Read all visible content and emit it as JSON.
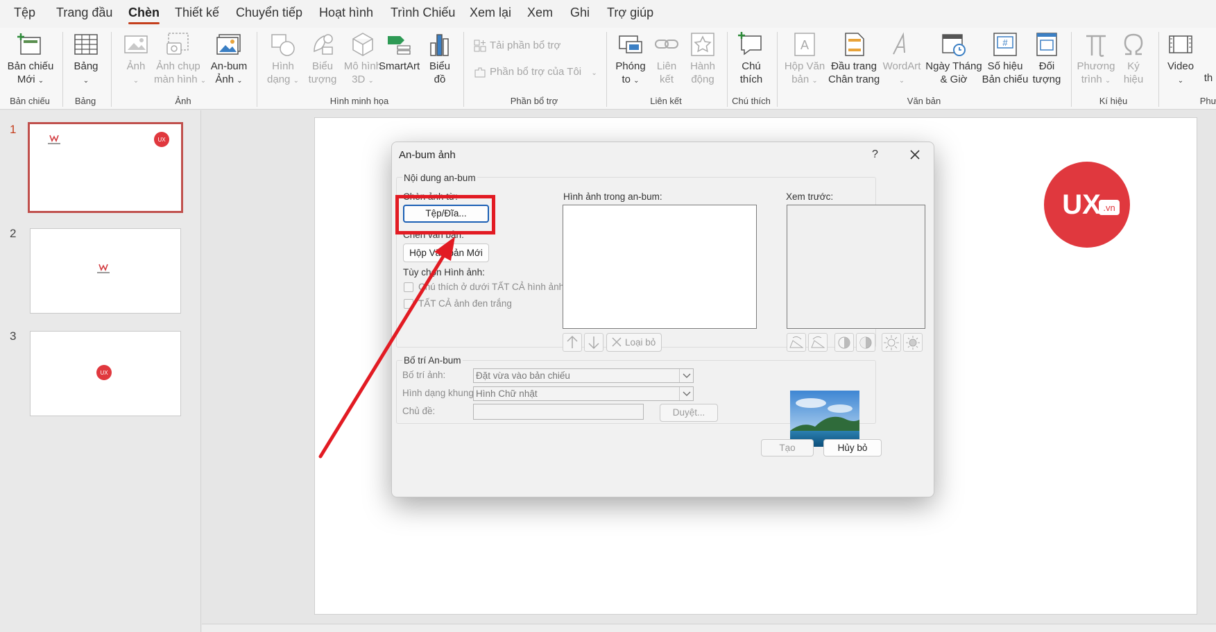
{
  "menu": {
    "items": [
      "Tệp",
      "Trang đầu",
      "Chèn",
      "Thiết kế",
      "Chuyển tiếp",
      "Hoạt hình",
      "Trình Chiếu",
      "Xem lại",
      "Xem",
      "Ghi",
      "Trợ giúp"
    ],
    "active": "Chèn"
  },
  "ribbon": {
    "new_slide": {
      "line1": "Bản chiếu",
      "line2": "Mới"
    },
    "table": {
      "line1": "Bảng"
    },
    "picture": {
      "line1": "Ảnh"
    },
    "screenshot": {
      "line1": "Ảnh chụp",
      "line2": "màn hình"
    },
    "album": {
      "line1": "An-bum",
      "line2": "Ảnh"
    },
    "shapes": {
      "line1": "Hình",
      "line2": "dạng"
    },
    "icons": {
      "line1": "Biểu",
      "line2": "tượng"
    },
    "models3d": {
      "line1": "Mô hình",
      "line2": "3D"
    },
    "smartart": {
      "line1": "SmartArt"
    },
    "chart": {
      "line1": "Biểu",
      "line2": "đồ"
    },
    "get_addins": "Tải phần bổ trợ",
    "my_addins": "Phần bổ trợ của Tôi",
    "zoom": {
      "line1": "Phóng",
      "line2": "to"
    },
    "link": {
      "line1": "Liên",
      "line2": "kết"
    },
    "action": {
      "line1": "Hành",
      "line2": "động"
    },
    "comment": {
      "line1": "Chú",
      "line2": "thích"
    },
    "textbox": {
      "line1": "Hộp Văn",
      "line2": "bản"
    },
    "header_footer": {
      "line1": "Đầu trang",
      "line2": "Chân trang"
    },
    "wordart": {
      "line1": "WordArt"
    },
    "datetime": {
      "line1": "Ngày Tháng",
      "line2": "& Giờ"
    },
    "slide_number": {
      "line1": "Số hiệu",
      "line2": "Bản chiếu"
    },
    "object": {
      "line1": "Đối",
      "line2": "tượng"
    },
    "equation": {
      "line1": "Phương",
      "line2": "trình"
    },
    "symbol": {
      "line1": "Ký",
      "line2": "hiệu"
    },
    "video": {
      "line1": "Video"
    },
    "cut1": "th",
    "groups": {
      "slides": "Bản chiếu",
      "tables": "Bảng",
      "images": "Ảnh",
      "illustrations": "Hình minh họa",
      "addins": "Phần bổ trợ",
      "links": "Liên kết",
      "comments": "Chú thích",
      "text": "Văn bản",
      "symbols": "Kí hiệu",
      "media_cut": "Phư"
    }
  },
  "thumbnails": [
    "1",
    "2",
    "3"
  ],
  "slide": {
    "logo_text": "UX",
    "logo_suffix": ".vn",
    "brand_color": "#e0383e"
  },
  "dialog": {
    "title": "An-bum ảnh",
    "help": "?",
    "album_content": "Nội dung an-bum",
    "insert_picture_from": "Chèn ảnh từ:",
    "file_disk_button": "Tệp/Đĩa...",
    "insert_text": "Chèn văn bản:",
    "new_textbox_button": "Hộp Văn bản Mới",
    "picture_options": "Tùy chọn Hình ảnh:",
    "caption_below": "Chú thích ở dưới TẤT CẢ hình ảnh",
    "all_black_white": "TẤT CẢ ảnh đen trắng",
    "pictures_in_album": "Hình ảnh trong an-bum:",
    "preview": "Xem trước:",
    "remove_button": "Loại bỏ",
    "album_layout": "Bố trí An-bum",
    "picture_layout_label": "Bố trí ảnh:",
    "picture_layout_value": "Đặt vừa vào bản chiếu",
    "frame_shape_label": "Hình dạng khung:",
    "frame_shape_value": "Hình Chữ nhật",
    "theme_label": "Chủ đề:",
    "browse_button": "Duyệt...",
    "create_button": "Tạo",
    "cancel_button": "Hủy bỏ"
  },
  "annotation": {
    "color": "#e21b23"
  }
}
